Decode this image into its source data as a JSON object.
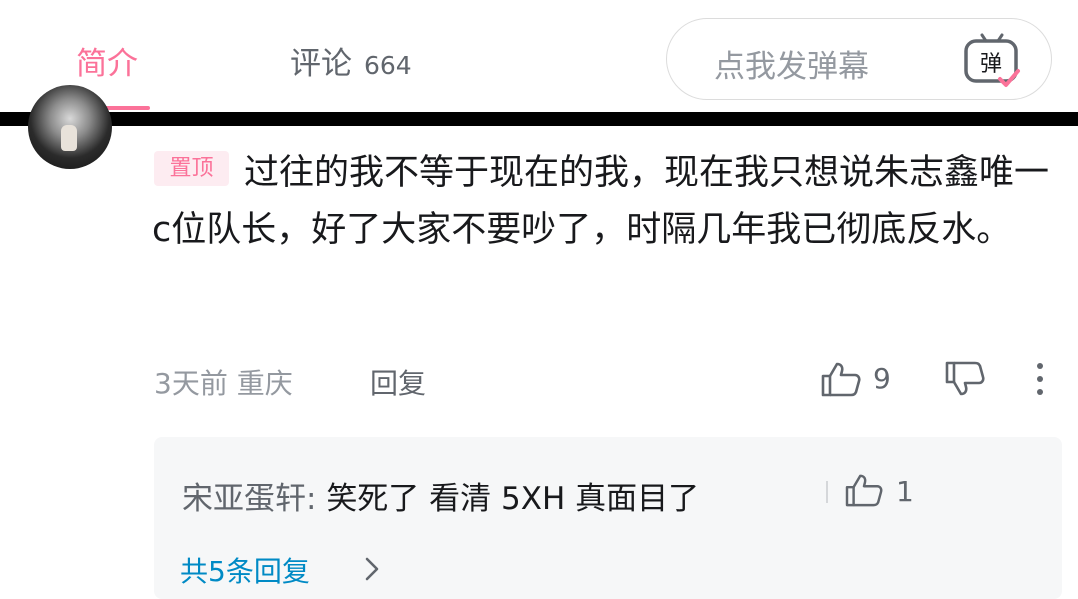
{
  "tabs": {
    "intro_label": "简介",
    "comments_label": "评论",
    "comments_count": "664"
  },
  "danmaku": {
    "placeholder": "点我发弹幕",
    "icon": "danmaku-toggle-icon",
    "icon_glyph": "弹"
  },
  "comment": {
    "avatar": "user-avatar",
    "pinned_label": "置顶",
    "text": "过往的我不等于现在的我，现在我只想说朱志鑫唯一c位队长，好了大家不要吵了，时隔几年我已彻底反水。",
    "time": "3天前",
    "location": "重庆",
    "reply_label": "回复",
    "like_count": "9",
    "icons": [
      "thumbs-up-icon",
      "thumbs-down-icon",
      "more-vertical-icon"
    ]
  },
  "replies": {
    "items": [
      {
        "user": "宋亚蛋轩:",
        "text": "笑死了 看清 5XH 真面目了",
        "like_count": "1"
      }
    ],
    "more_label": "共5条回复"
  },
  "colors": {
    "accent_pink": "#fb7299",
    "pinned_bg": "#fdecf1",
    "link_blue": "#008ac5",
    "secondary_text": "#61666d",
    "muted_text": "#9499a0"
  }
}
